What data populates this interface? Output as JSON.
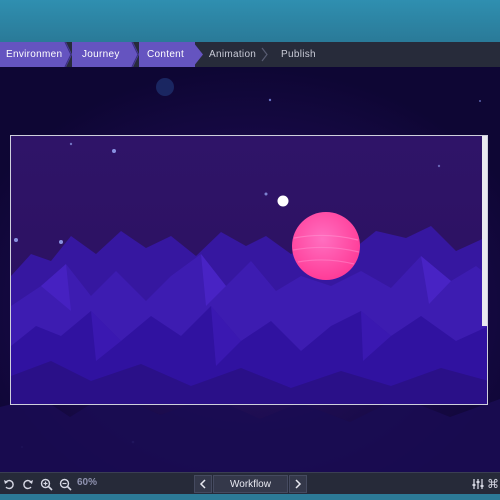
{
  "breadcrumb": {
    "items": [
      {
        "label": "Environment",
        "state": "active"
      },
      {
        "label": "Journey",
        "state": "active"
      },
      {
        "label": "Content",
        "state": "active"
      },
      {
        "label": "Animation",
        "state": "inactive"
      },
      {
        "label": "Publish",
        "state": "inactive"
      }
    ]
  },
  "toolbar": {
    "zoom_label": "60%",
    "workflow_label": "Workflow",
    "icons": [
      "undo-icon",
      "redo-icon",
      "zoom-in-icon",
      "zoom-out-icon",
      "prev-icon",
      "next-icon",
      "sliders-icon",
      "command-icon"
    ]
  },
  "colors": {
    "active_crumb": "#6554c0",
    "planet": "#ff4fa8",
    "sky": "#2a1060",
    "mountains": "#3a1ca0"
  }
}
